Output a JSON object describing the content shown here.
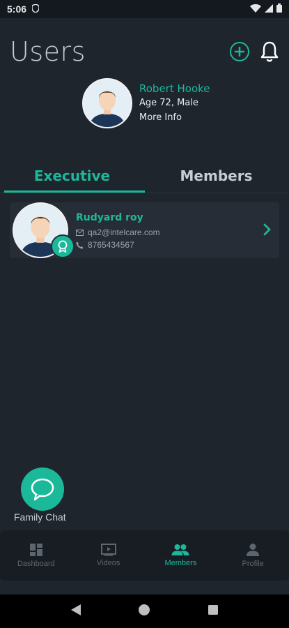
{
  "status": {
    "time": "5:06",
    "app_icon": "shield-icon"
  },
  "header": {
    "title": "Users",
    "add_icon": "add-circle-icon",
    "bell_icon": "bell-icon"
  },
  "profile": {
    "name": "Robert Hooke",
    "age_gender": "Age 72, Male",
    "more_info": "More Info"
  },
  "tabs": [
    {
      "label": "Executive",
      "active": true
    },
    {
      "label": "Members",
      "active": false
    }
  ],
  "members": [
    {
      "name": "Rudyard roy",
      "email": "qa2@intelcare.com",
      "phone": "8765434567"
    }
  ],
  "chat": {
    "label": "Family Chat"
  },
  "nav": [
    {
      "label": "Dashboard",
      "icon": "dashboard-icon",
      "active": false
    },
    {
      "label": "Videos",
      "icon": "video-icon",
      "active": false
    },
    {
      "label": "Members",
      "icon": "members-icon",
      "active": true
    },
    {
      "label": "Profile",
      "icon": "profile-icon",
      "active": false
    }
  ],
  "colors": {
    "accent": "#1bb99a",
    "background": "#1f252d",
    "card": "#262d36"
  }
}
